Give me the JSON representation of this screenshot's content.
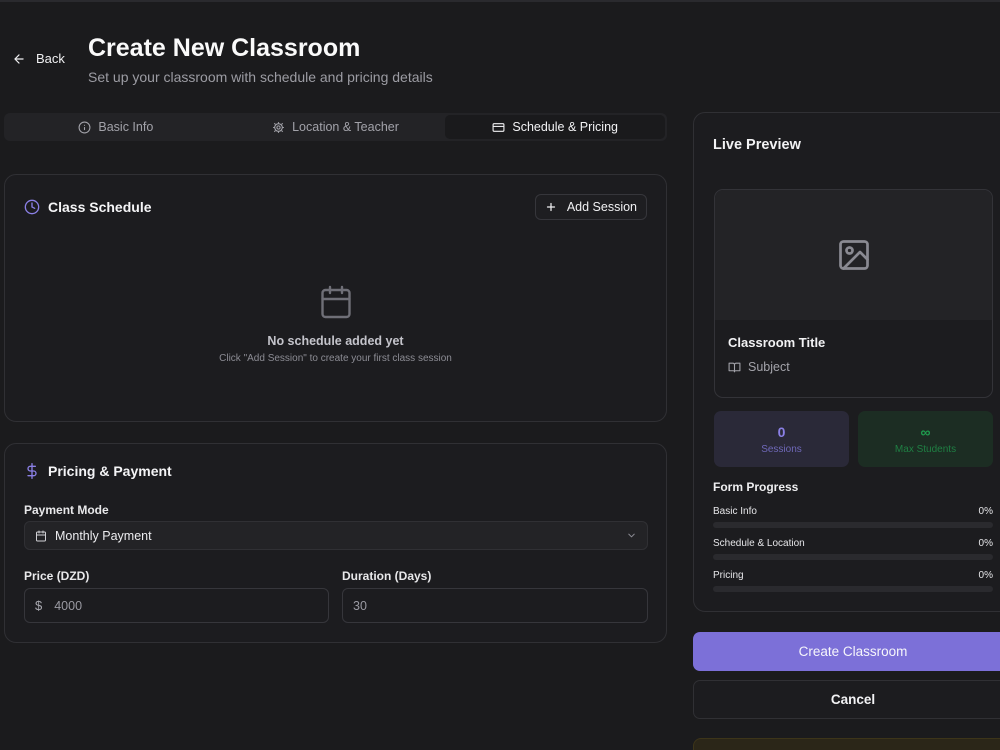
{
  "header": {
    "back_label": "Back",
    "title": "Create New Classroom",
    "subtitle": "Set up your classroom with schedule and pricing details"
  },
  "tabs": [
    {
      "label": "Basic Info",
      "icon": "info-icon",
      "active": false
    },
    {
      "label": "Location & Teacher",
      "icon": "gear-icon",
      "active": false
    },
    {
      "label": "Schedule & Pricing",
      "icon": "credit-card-icon",
      "active": true
    }
  ],
  "schedule": {
    "title": "Class Schedule",
    "add_label": "Add Session",
    "empty_title": "No schedule added yet",
    "empty_sub": "Click \"Add Session\" to create your first class session"
  },
  "pricing": {
    "title": "Pricing & Payment",
    "payment_mode_label": "Payment Mode",
    "payment_mode_value": "Monthly Payment",
    "price_label": "Price (DZD)",
    "price_placeholder": "4000",
    "currency_symbol": "$",
    "duration_label": "Duration (Days)",
    "duration_placeholder": "30"
  },
  "preview": {
    "title": "Live Preview",
    "classroom_title": "Classroom Title",
    "subject": "Subject",
    "sessions_value": "0",
    "sessions_label": "Sessions",
    "max_students_value": "∞",
    "max_students_label": "Max Students",
    "progress_title": "Form Progress",
    "progress": [
      {
        "label": "Basic Info",
        "value": "0%",
        "fraction": 0
      },
      {
        "label": "Schedule & Location",
        "value": "0%",
        "fraction": 0
      },
      {
        "label": "Pricing",
        "value": "0%",
        "fraction": 0
      }
    ]
  },
  "actions": {
    "create_label": "Create Classroom",
    "cancel_label": "Cancel"
  },
  "colors": {
    "accent": "#7c70d8",
    "sessions_text": "#8b80e6",
    "max_students_text": "#1f9d4e"
  }
}
